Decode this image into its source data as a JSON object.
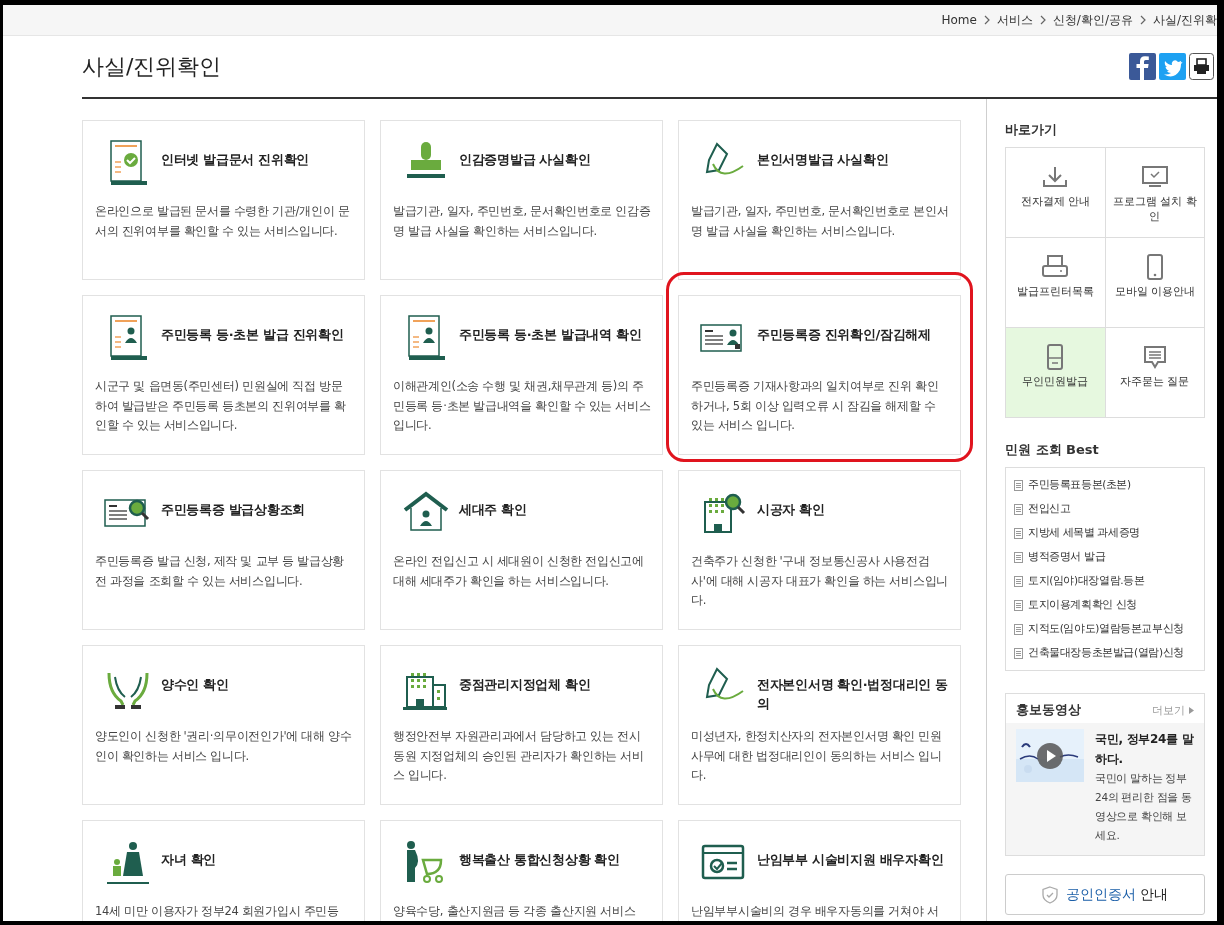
{
  "breadcrumb": [
    "Home",
    "서비스",
    "신청/확인/공유",
    "사실/진위확"
  ],
  "page_title": "사실/진위확인",
  "cards": [
    {
      "title": "인터넷 발급문서 진위확인",
      "description": "온라인으로 발급된 문서를 수령한 기관/개인이 문서의 진위여부를 확인할 수 있는 서비스입니다.",
      "highlighted": false
    },
    {
      "title": "인감증명발급 사실확인",
      "description": "발급기관, 일자, 주민번호, 문서확인번호로 인감증명 발급 사실을 확인하는 서비스입니다.",
      "highlighted": false
    },
    {
      "title": "본인서명발급 사실확인",
      "description": "발급기관, 일자, 주민번호, 문서확인번호로 본인서명 발급 사실을 확인하는 서비스입니다.",
      "highlighted": false
    },
    {
      "title": "주민등록 등·초본 발급 진위확인",
      "description": "시군구 및 읍면동(주민센터) 민원실에 직접 방문하여 발급받은 주민등록 등초본의 진위여부를 확인할 수 있는 서비스입니다.",
      "highlighted": false
    },
    {
      "title": "주민등록 등·초본 발급내역 확인",
      "description": "이해관계인(소송 수행 및 채권,채무관계 등)의 주민등록 등·초본 발급내역을 확인할 수 있는 서비스입니다.",
      "highlighted": false
    },
    {
      "title": "주민등록증 진위확인/잠김해제",
      "description": "주민등록증 기재사항과의 일치여부로 진위 확인하거나, 5회 이상 입력오류 시 잠김을 해제할 수 있는 서비스 입니다.",
      "highlighted": true
    },
    {
      "title": "주민등록증 발급상황조회",
      "description": "주민등록증 발급 신청, 제작 및 교부 등 발급상황 전 과정을 조회할 수 있는 서비스입니다.",
      "highlighted": false
    },
    {
      "title": "세대주 확인",
      "description": "온라인 전입신고 시 세대원이 신청한 전입신고에 대해 세대주가 확인을 하는 서비스입니다.",
      "highlighted": false
    },
    {
      "title": "시공자 확인",
      "description": "건축주가 신청한 '구내 정보통신공사 사용전검사'에 대해 시공자 대표가 확인을 하는 서비스입니다.",
      "highlighted": false
    },
    {
      "title": "양수인 확인",
      "description": "양도인이 신청한 '권리·의무이전인가'에 대해 양수인이 확인하는 서비스 입니다.",
      "highlighted": false
    },
    {
      "title": "중점관리지정업체 확인",
      "description": "행정안전부 자원관리과에서 담당하고 있는 전시동원 지정업체의 승인된 관리자가 확인하는 서비스 입니다.",
      "highlighted": false
    },
    {
      "title": "전자본인서명 확인·법정대리인 동의",
      "description": "미성년자, 한정치산자의 전자본인서명 확인 민원사무에 대한 법정대리인이 동의하는 서비스 입니다.",
      "highlighted": false
    },
    {
      "title": "자녀 확인",
      "description": "14세 미만 이용자가 정부24 회원가입시 주민등",
      "highlighted": false
    },
    {
      "title": "행복출산 통합신청상황 확인",
      "description": "양육수당, 출산지원금 등 각종 출산지원 서비스",
      "highlighted": false
    },
    {
      "title": "난임부부 시술비지원 배우자확인",
      "description": "난임부부시술비의 경우 배우자동의를 거쳐야 서",
      "highlighted": false
    }
  ],
  "quick_links": {
    "title": "바로가기",
    "items": [
      {
        "label": "전자결제 안내",
        "selected": false
      },
      {
        "label": "프로그램 설치 확인",
        "selected": false
      },
      {
        "label": "발급프린터목록",
        "selected": false
      },
      {
        "label": "모바일 이용안내",
        "selected": false
      },
      {
        "label": "무인민원발급",
        "selected": true
      },
      {
        "label": "자주묻는 질문",
        "selected": false
      }
    ]
  },
  "best": {
    "title": "민원 조회 Best",
    "items": [
      "주민등록표등본(초본)",
      "전입신고",
      "지방세 세목별 과세증명",
      "병적증명서 발급",
      "토지(임야)대장열람.등본",
      "토지이용계획확인 신청",
      "지적도(임야도)열람등본교부신청",
      "건축물대장등초본발급(열람)신청"
    ]
  },
  "video": {
    "title": "홍보동영상",
    "more": "더보기",
    "headline": "국민, 정부24를 말하다.",
    "description": "국민이 말하는 정부24의 편리한 점을 동영상으로 확인해 보세요."
  },
  "certificate_button": {
    "highlight": "공인인증서",
    "text": "안내"
  }
}
